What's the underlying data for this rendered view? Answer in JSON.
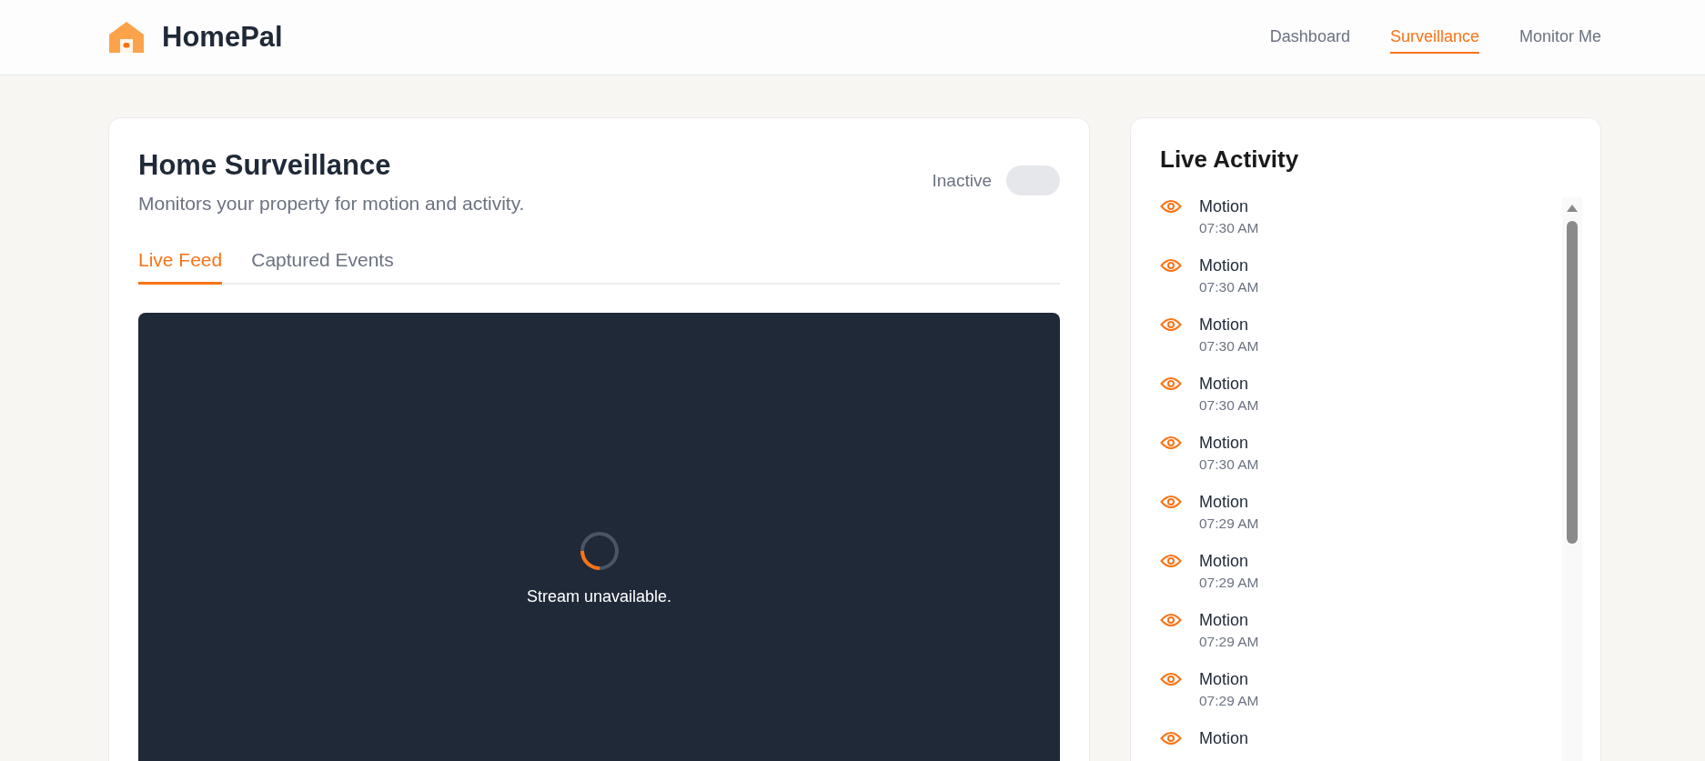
{
  "header": {
    "brand": "HomePal",
    "nav": [
      {
        "label": "Dashboard",
        "selected": false
      },
      {
        "label": "Surveillance",
        "selected": true
      },
      {
        "label": "Monitor Me",
        "selected": false
      }
    ]
  },
  "surveillance": {
    "title": "Home Surveillance",
    "subtitle": "Monitors your property for motion and activity.",
    "status_label": "Inactive",
    "on": false,
    "tabs": [
      {
        "label": "Live Feed",
        "selected": true
      },
      {
        "label": "Captured Events",
        "selected": false
      }
    ],
    "feed": {
      "message": "Stream unavailable."
    }
  },
  "activity": {
    "title": "Live Activity",
    "items": [
      {
        "event": "Motion",
        "time": "07:30 AM"
      },
      {
        "event": "Motion",
        "time": "07:30 AM"
      },
      {
        "event": "Motion",
        "time": "07:30 AM"
      },
      {
        "event": "Motion",
        "time": "07:30 AM"
      },
      {
        "event": "Motion",
        "time": "07:30 AM"
      },
      {
        "event": "Motion",
        "time": "07:29 AM"
      },
      {
        "event": "Motion",
        "time": "07:29 AM"
      },
      {
        "event": "Motion",
        "time": "07:29 AM"
      },
      {
        "event": "Motion",
        "time": "07:29 AM"
      },
      {
        "event": "Motion"
      }
    ]
  }
}
